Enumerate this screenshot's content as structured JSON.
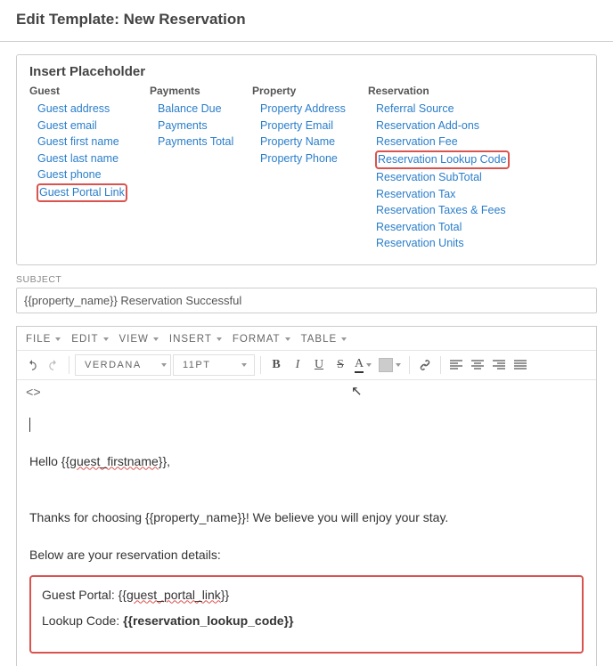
{
  "title": "Edit Template: New Reservation",
  "panel": {
    "heading": "Insert Placeholder",
    "columns": [
      {
        "header": "Guest",
        "links": [
          "Guest address",
          "Guest email",
          "Guest first name",
          "Guest last name",
          "Guest phone",
          "Guest Portal Link"
        ]
      },
      {
        "header": "Payments",
        "links": [
          "Balance Due",
          "Payments",
          "Payments Total"
        ]
      },
      {
        "header": "Property",
        "links": [
          "Property Address",
          "Property Email",
          "Property Name",
          "Property Phone"
        ]
      },
      {
        "header": "Reservation",
        "links": [
          "Referral Source",
          "Reservation Add-ons",
          "Reservation Fee",
          "Reservation Lookup Code",
          "Reservation SubTotal",
          "Reservation Tax",
          "Reservation Taxes & Fees",
          "Reservation Total",
          "Reservation Units"
        ]
      }
    ]
  },
  "subject": {
    "label": "SUBJECT",
    "value": "{{property_name}} Reservation Successful"
  },
  "editor": {
    "menus": [
      "FILE",
      "EDIT",
      "VIEW",
      "INSERT",
      "FORMAT",
      "TABLE"
    ],
    "font": "VERDANA",
    "size": "11PT",
    "body_line1": "Hello {{",
    "body_line1_sq": "guest_firstname",
    "body_line1_end": "}},",
    "body_line2": "Thanks for choosing {{property_name}}! We believe you will enjoy your stay.",
    "body_line3": "Below are your reservation details:",
    "box_line1_a": "Guest Portal: {{",
    "box_line1_b": "guest_portal_link",
    "box_line1_c": "}}",
    "box_line2_a": "Lookup Code: ",
    "box_line2_b": "{{reservation_lookup_code}}"
  }
}
